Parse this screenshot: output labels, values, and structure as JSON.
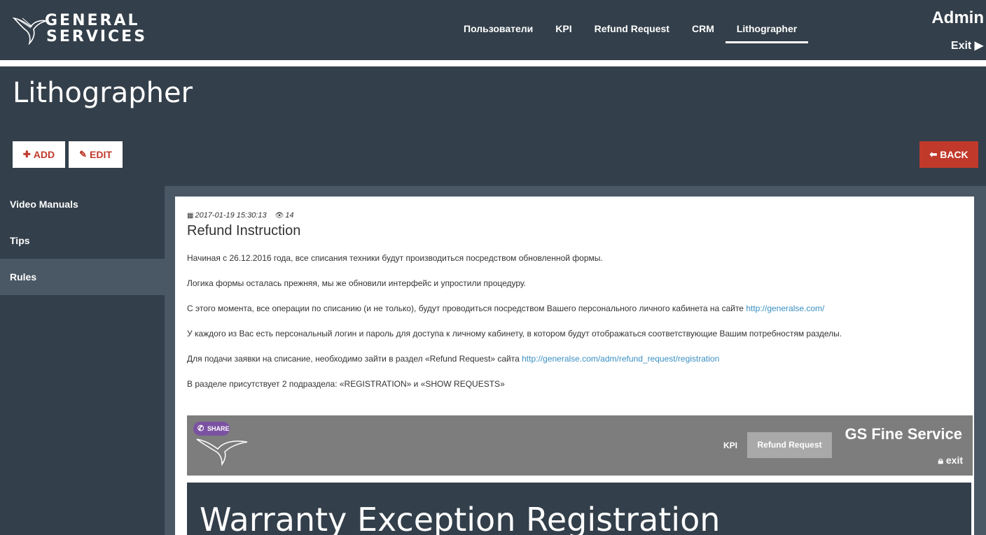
{
  "logo": {
    "line1": "GENERAL",
    "line2": "SERVICES"
  },
  "nav": {
    "items": [
      {
        "label": "Пользователи"
      },
      {
        "label": "KPI"
      },
      {
        "label": "Refund Request"
      },
      {
        "label": "CRM"
      },
      {
        "label": "Lithographer"
      }
    ],
    "active_index": 4
  },
  "user": {
    "name": "Admin",
    "exit_label": "Exit ▶"
  },
  "page": {
    "title": "Lithographer"
  },
  "toolbar": {
    "add_label": "ADD",
    "edit_label": "EDIT",
    "back_label": "BACK"
  },
  "sidebar": {
    "items": [
      {
        "label": "Video Manuals"
      },
      {
        "label": "Tips"
      },
      {
        "label": "Rules"
      }
    ],
    "active_index": 2
  },
  "article": {
    "date": "2017-01-19 15:30:13",
    "views": "14",
    "title": "Refund Instruction",
    "p1": "Начиная с 26.12.2016 года, все списания техники будут производиться посредством обновленной формы.",
    "p2": "Логика формы осталась прежняя, мы же обновили интерфейс и упростили процедуру.",
    "p3": "С этого момента, все операции по списанию (и не только), будут проводиться посредством Вашего персонального личного кабинета на сайте ",
    "p3_link": "http://generalse.com/",
    "p4": "У каждого из Вас есть персональный логин и пароль для доступа к личному кабинету, в котором будут отображаться соответствующие Вашим потребностям разделы.",
    "p5": "Для подачи заявки на списание, необходимо зайти в раздел «Refund Request» сайта ",
    "p5_link": "http://generalse.com/adm/refund_request/registration",
    "p6": "В разделе присутствует 2 подраздела: «REGISTRATION» и «SHOW REQUESTS»"
  },
  "embed": {
    "share_label": "SHARE",
    "kpi_label": "KPI",
    "refund_button": "Refund Request",
    "brand": "GS Fine Service",
    "exit_label": "exit",
    "heading": "Warranty Exception Registration"
  },
  "colors": {
    "bg": "#333f4a",
    "panel": "#4a5764",
    "accent": "#c0392b",
    "link": "#3a8fc1",
    "viber": "#7b52a1"
  }
}
